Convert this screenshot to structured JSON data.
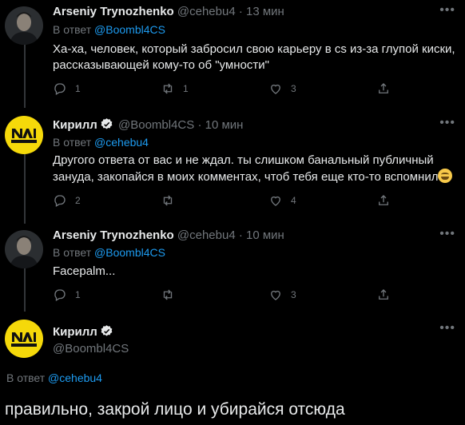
{
  "tweets": [
    {
      "name": "Arseniy Trynozhenko",
      "handle": "@cehebu4",
      "time": "13 мин",
      "reply_prefix": "В ответ",
      "reply_to": "@Boombl4CS",
      "text": "Ха-ха, человек, который забросил свою карьеру в cs из-за глупой киски, рассказывающей кому-то об \"умности\"",
      "replies": "1",
      "retweets": "1",
      "likes": "3"
    },
    {
      "name": "Кирилл",
      "handle": "@Boombl4CS",
      "time": "10 мин",
      "reply_prefix": "В ответ",
      "reply_to": "@cehebu4",
      "text": "Другого ответа от вас и не ждал. ты слишком банальный публичный зануда, закопайся в моих комментах, чтоб тебя еще кто-то вспомнил",
      "replies": "2",
      "retweets": "",
      "likes": "4"
    },
    {
      "name": "Arseniy Trynozhenko",
      "handle": "@cehebu4",
      "time": "10 мин",
      "reply_prefix": "В ответ",
      "reply_to": "@Boombl4CS",
      "text": "Facepalm...",
      "replies": "1",
      "retweets": "",
      "likes": "3"
    }
  ],
  "main": {
    "name": "Кирилл",
    "handle": "@Boombl4CS",
    "reply_prefix": "В ответ",
    "reply_to": "@cehebu4",
    "text": "правильно, закрой лицо и убирайся отсюда"
  },
  "symbols": {
    "dot": "·",
    "more": "•••"
  },
  "icons": [
    "reply-icon",
    "retweet-icon",
    "like-icon",
    "share-icon",
    "verified-icon",
    "more-icon"
  ],
  "colors": {
    "background": "#000000",
    "text": "#e7e9ea",
    "muted": "#71767b",
    "accent": "#1d9bf0",
    "navi_yellow": "#f5d90a"
  }
}
